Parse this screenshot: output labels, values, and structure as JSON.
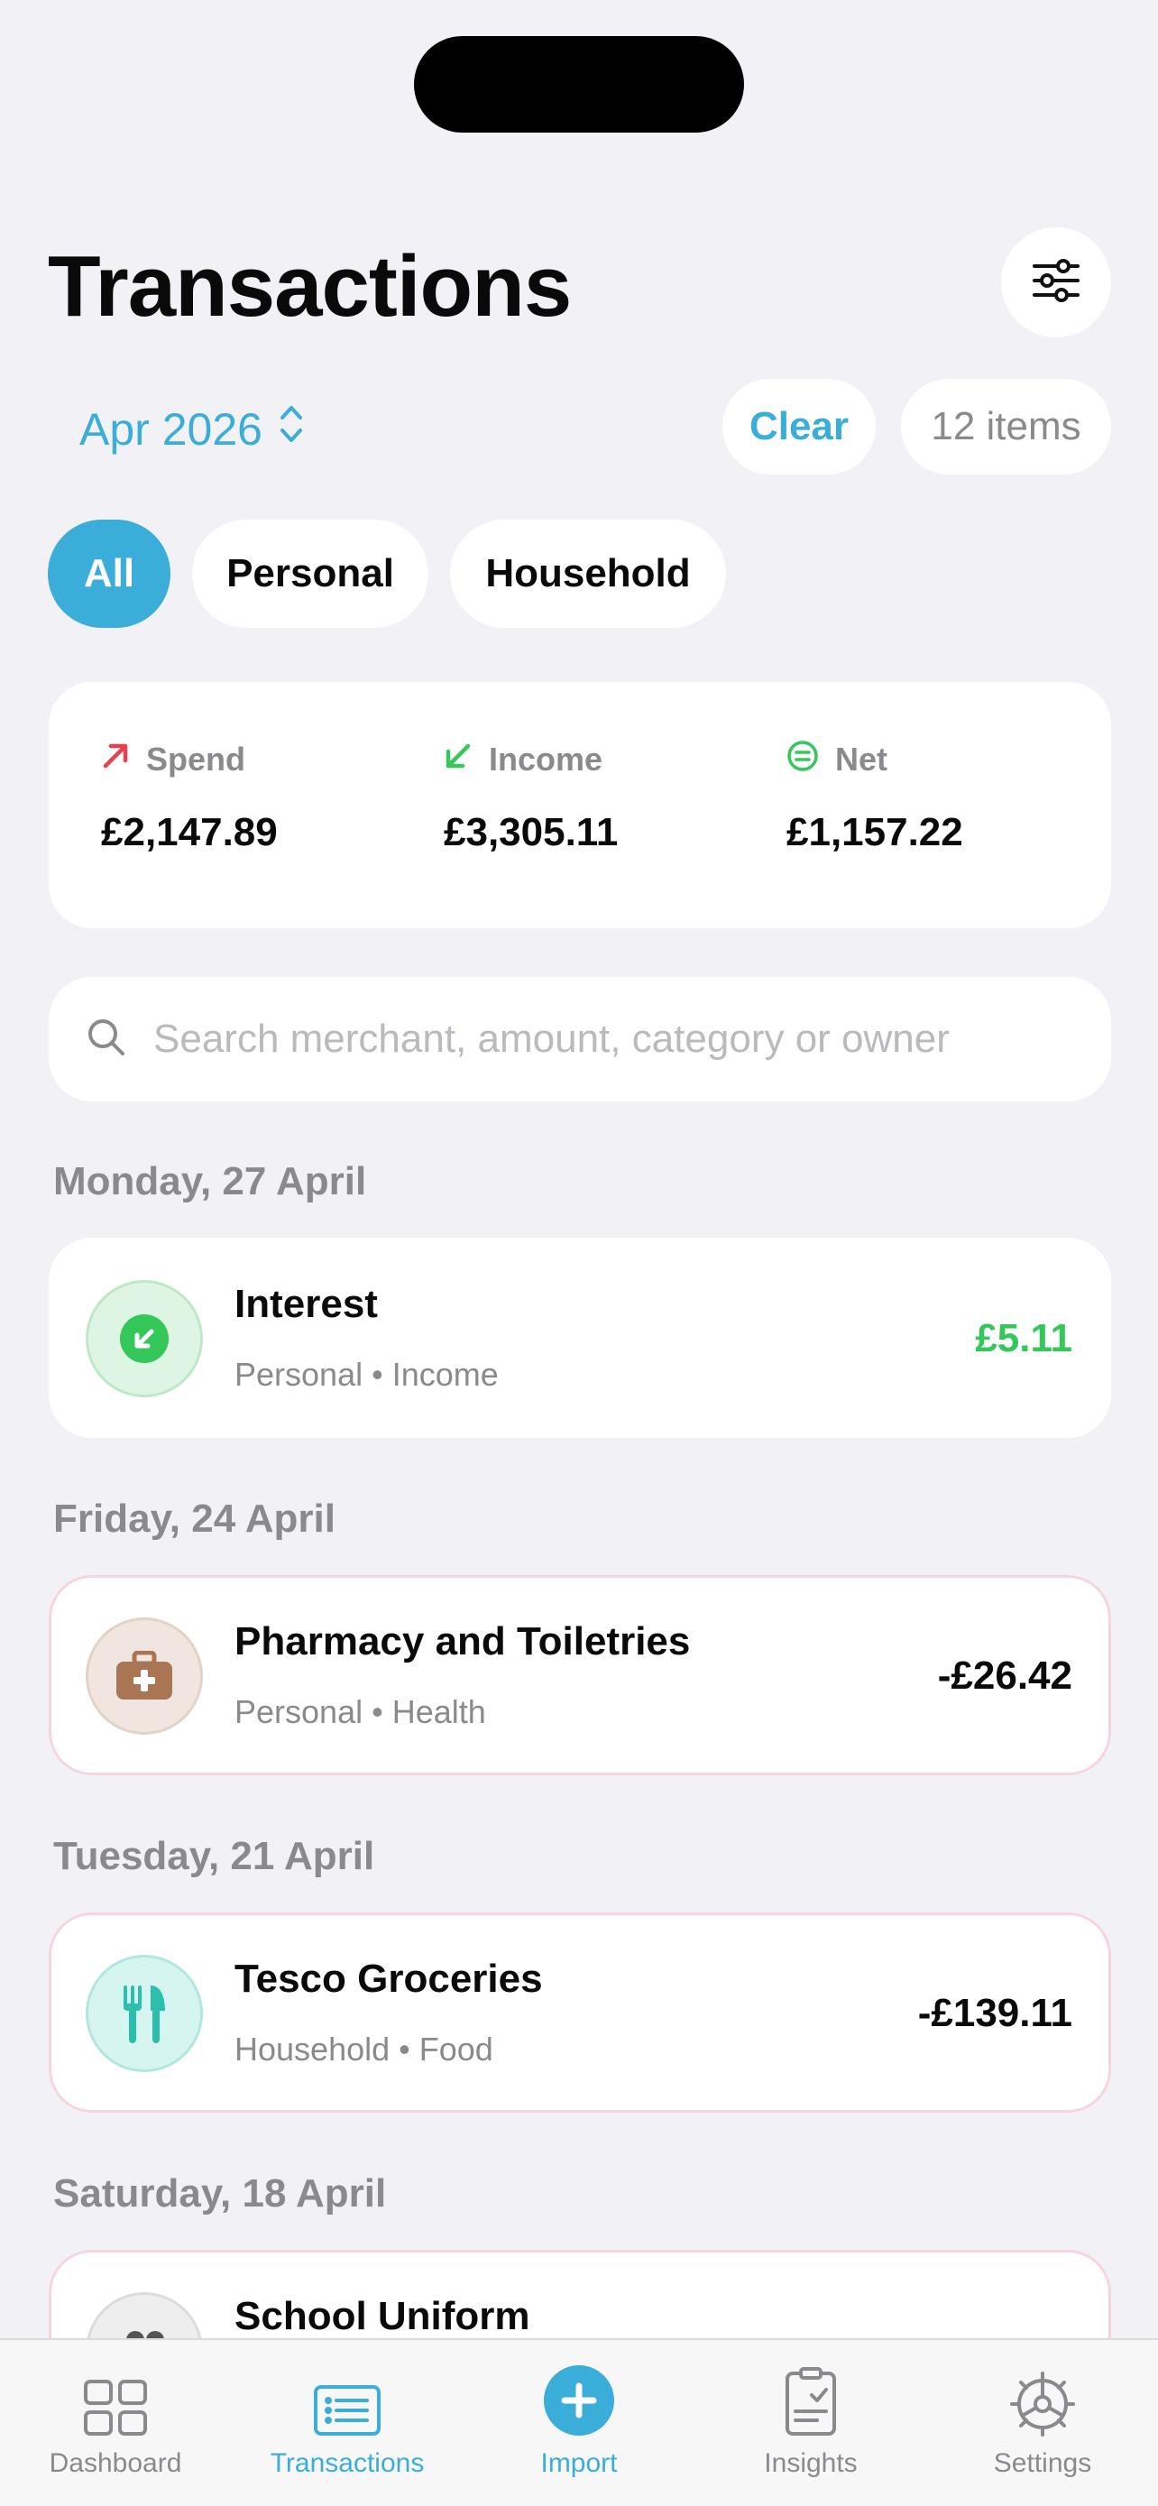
{
  "header": {
    "title": "Transactions",
    "filter_icon": "sliders-icon"
  },
  "period": {
    "label": "Apr 2026",
    "clear_label": "Clear",
    "count_label": "12 items"
  },
  "segments": [
    {
      "label": "All",
      "active": true
    },
    {
      "label": "Personal",
      "active": false
    },
    {
      "label": "Household",
      "active": false
    }
  ],
  "summary": {
    "spend": {
      "label": "Spend",
      "value": "£2,147.89",
      "color": "#e8414d"
    },
    "income": {
      "label": "Income",
      "value": "£3,305.11",
      "color": "#34c759"
    },
    "net": {
      "label": "Net",
      "value": "£1,157.22",
      "color": "#34c759"
    }
  },
  "search": {
    "placeholder": "Search merchant, amount, category or owner",
    "value": ""
  },
  "groups": [
    {
      "date": "Monday, 27 April",
      "items": [
        {
          "title": "Interest",
          "owner": "Personal",
          "category": "Income",
          "amount": "£5.11",
          "icon": "income-arrow-icon",
          "amount_color": "#34c759"
        }
      ]
    },
    {
      "date": "Friday, 24 April",
      "items": [
        {
          "title": "Pharmacy and Toiletries",
          "owner": "Personal",
          "category": "Health",
          "amount": "-£26.42",
          "icon": "medical-bag-icon"
        }
      ]
    },
    {
      "date": "Tuesday, 21 April",
      "items": [
        {
          "title": "Tesco Groceries",
          "owner": "Household",
          "category": "Food",
          "amount": "-£139.11",
          "icon": "fork-knife-icon"
        }
      ]
    },
    {
      "date": "Saturday, 18 April",
      "items": [
        {
          "title": "School Uniform",
          "owner": "",
          "category": "",
          "amount": "",
          "icon": "people-icon"
        }
      ]
    }
  ],
  "tabbar": [
    {
      "label": "Dashboard",
      "icon": "grid-icon"
    },
    {
      "label": "Transactions",
      "icon": "list-icon",
      "active": true
    },
    {
      "label": "Import",
      "icon": "plus-circle-icon"
    },
    {
      "label": "Insights",
      "icon": "clipboard-check-icon"
    },
    {
      "label": "Settings",
      "icon": "gear-icon"
    }
  ],
  "colors": {
    "accent": "#3aaed8",
    "background": "#f2f2f6"
  }
}
